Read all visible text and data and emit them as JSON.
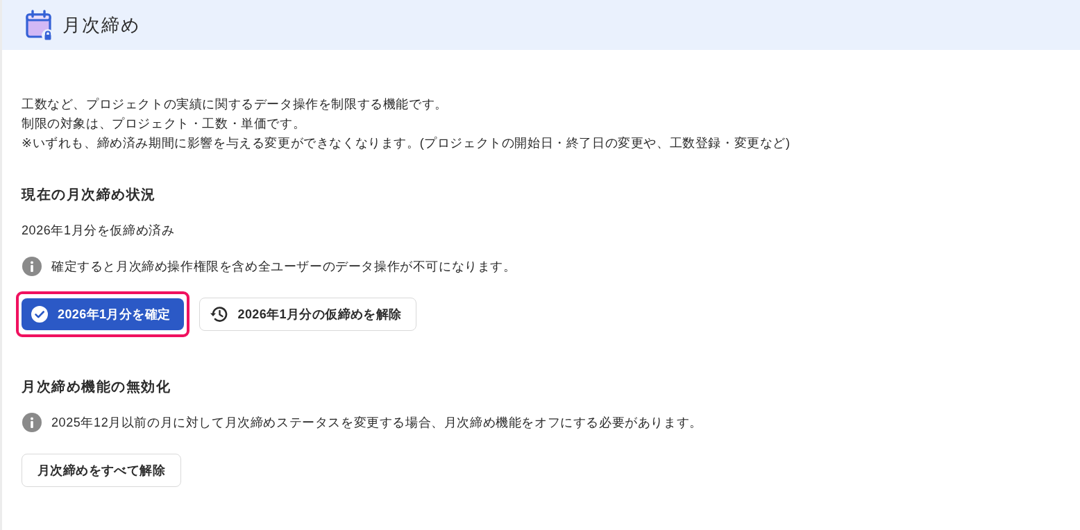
{
  "header": {
    "title": "月次締め"
  },
  "description": [
    "工数など、プロジェクトの実績に関するデータ操作を制限する機能です。",
    "制限の対象は、プロジェクト・工数・単価です。",
    "※いずれも、締め済み期間に影響を与える変更ができなくなります。(プロジェクトの開始日・終了日の変更や、工数登録・変更など)"
  ],
  "sections": [
    {
      "heading": "現在の月次締め状況",
      "status": "2026年1月分を仮締め済み",
      "notice": "確定すると月次締め操作権限を含め全ユーザーのデータ操作が不可になります。",
      "buttons": [
        {
          "label": "2026年1月分を確定",
          "kind": "confirm",
          "highlighted": true
        },
        {
          "label": "2026年1月分の仮締めを解除",
          "kind": "revert",
          "highlighted": false
        }
      ]
    },
    {
      "heading": "月次締め機能の無効化",
      "notice": "2025年12月以前の月に対して月次締めステータスを変更する場合、月次締め機能をオフにする必要があります。",
      "buttons": [
        {
          "label": "月次締めをすべて解除",
          "kind": "plain",
          "highlighted": false
        }
      ]
    }
  ]
}
